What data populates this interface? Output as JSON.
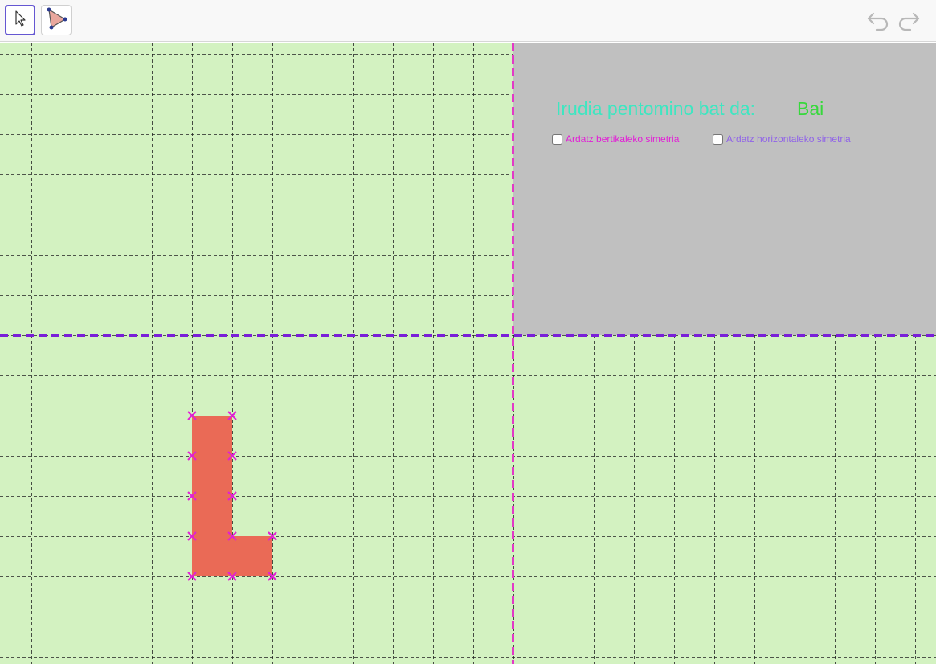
{
  "toolbar": {
    "tools": [
      {
        "name": "move",
        "icon": "cursor-arrow-icon",
        "active": true
      },
      {
        "name": "polygon",
        "icon": "polygon-triangle-icon",
        "active": false
      }
    ],
    "undo_icon": "undo-icon",
    "redo_icon": "redo-icon"
  },
  "panel": {
    "heading": "Irudia pentomino bat da:",
    "answer": "Bai",
    "checkboxes": [
      {
        "label": "Ardatz bertikaleko simetria",
        "checked": false,
        "color": "#e21fd6"
      },
      {
        "label": "Ardatz horizontaleko simetria",
        "checked": false,
        "color": "#9063e8"
      }
    ]
  },
  "colors": {
    "grid_background": "#d3f2c1",
    "panel_background": "#c0c0c0",
    "shape_fill": "#ea6a56",
    "vertex_marker": "#e21fd6",
    "vertical_axis": "#e23ac6",
    "horizontal_axis": "#7a1fd8",
    "heading": "#3ee6c1",
    "answer": "#37d83c"
  },
  "shape": {
    "name": "L-pentomino",
    "cells": [
      [
        0,
        0
      ],
      [
        0,
        1
      ],
      [
        0,
        2
      ],
      [
        0,
        3
      ],
      [
        1,
        3
      ]
    ],
    "vertices": [
      [
        0,
        0
      ],
      [
        1,
        0
      ],
      [
        0,
        1
      ],
      [
        1,
        1
      ],
      [
        0,
        2
      ],
      [
        1,
        2
      ],
      [
        0,
        3
      ],
      [
        1,
        3
      ],
      [
        2,
        3
      ],
      [
        0,
        4
      ],
      [
        1,
        4
      ],
      [
        2,
        4
      ]
    ]
  }
}
